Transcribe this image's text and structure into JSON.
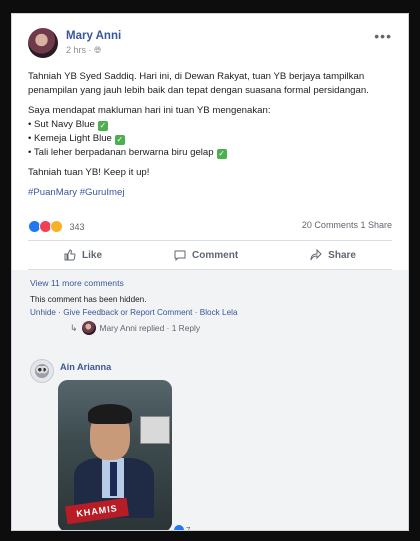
{
  "post": {
    "author": "Mary Anni",
    "time": "2 hrs · ",
    "more_label": "•••",
    "paragraphs": [
      "Tahniah YB Syed Saddiq. Hari ini, di Dewan Rakyat, tuan YB berjaya tampilkan penampilan yang jauh lebih baik dan tepat dengan suasana formal persidangan.",
      "Saya mendapat makluman hari ini tuan YB mengenakan:"
    ],
    "list": [
      "• Sut Navy Blue",
      "• Kemeja Light Blue",
      "• Tali leher berpadanan berwarna biru gelap"
    ],
    "closing": "Tahniah tuan YB! Keep it up!",
    "hashtags": "#PuanMary #GuruImej",
    "reaction_count": "343",
    "comments_count": "20 Comments",
    "shares_count": "1 Share",
    "actions": {
      "like": "Like",
      "comment": "Comment",
      "share": "Share"
    }
  },
  "comments": {
    "view_more": "View 11 more comments",
    "hidden_note": "This comment has been hidden.",
    "hidden_actions": "Unhide · Give Feedback or Report Comment · Block Lela",
    "reply_line": "Mary Anni replied · 1 Reply",
    "commenter": "Ain Arianna",
    "photo_tag": "KHAMIS",
    "reaction_badge": "7"
  },
  "colors": {
    "link": "#385898",
    "accent_like": "#2078f4",
    "background": "#ffffff"
  }
}
